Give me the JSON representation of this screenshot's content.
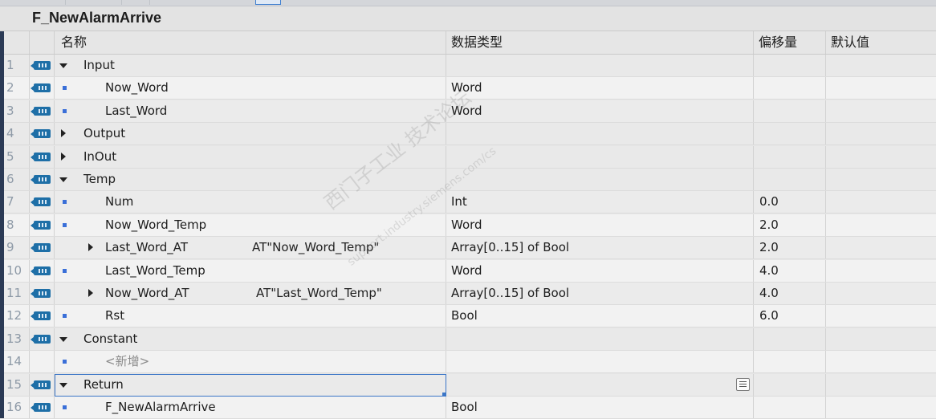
{
  "block_title": "F_NewAlarmArrive",
  "columns": {
    "name": "名称",
    "datatype": "数据类型",
    "offset": "偏移量",
    "default": "默认值"
  },
  "watermark": {
    "main": "西门子工业 技术论坛",
    "url": "support.industry.siemens.com/cs"
  },
  "rows": [
    {
      "num": "1",
      "icon": true,
      "expander": "down",
      "bullet": false,
      "name": "Input",
      "at": "",
      "type": "",
      "offset": ""
    },
    {
      "num": "2",
      "icon": true,
      "expander": "",
      "bullet": true,
      "name": "Now_Word",
      "at": "",
      "type": "Word",
      "offset": ""
    },
    {
      "num": "3",
      "icon": true,
      "expander": "",
      "bullet": true,
      "name": "Last_Word",
      "at": "",
      "type": "Word",
      "offset": ""
    },
    {
      "num": "4",
      "icon": true,
      "expander": "right",
      "bullet": false,
      "name": "Output",
      "at": "",
      "type": "",
      "offset": ""
    },
    {
      "num": "5",
      "icon": true,
      "expander": "right",
      "bullet": false,
      "name": "InOut",
      "at": "",
      "type": "",
      "offset": ""
    },
    {
      "num": "6",
      "icon": true,
      "expander": "down",
      "bullet": false,
      "name": "Temp",
      "at": "",
      "type": "",
      "offset": ""
    },
    {
      "num": "7",
      "icon": true,
      "expander": "",
      "bullet": true,
      "name": "Num",
      "at": "",
      "type": "Int",
      "offset": "0.0"
    },
    {
      "num": "8",
      "icon": true,
      "expander": "",
      "bullet": true,
      "name": "Now_Word_Temp",
      "at": "",
      "type": "Word",
      "offset": "2.0"
    },
    {
      "num": "9",
      "icon": true,
      "expander": "right-child",
      "bullet": false,
      "name": "Last_Word_AT",
      "at": "AT\"Now_Word_Temp\"",
      "type": "Array[0..15] of Bool",
      "offset": "2.0"
    },
    {
      "num": "10",
      "icon": true,
      "expander": "",
      "bullet": true,
      "name": "Last_Word_Temp",
      "at": "",
      "type": "Word",
      "offset": "4.0"
    },
    {
      "num": "11",
      "icon": true,
      "expander": "right-child",
      "bullet": false,
      "name": "Now_Word_AT",
      "at": "AT\"Last_Word_Temp\"",
      "type": "Array[0..15] of Bool",
      "offset": "4.0"
    },
    {
      "num": "12",
      "icon": true,
      "expander": "",
      "bullet": true,
      "name": "Rst",
      "at": "",
      "type": "Bool",
      "offset": "6.0"
    },
    {
      "num": "13",
      "icon": true,
      "expander": "down",
      "bullet": false,
      "name": "Constant",
      "at": "",
      "type": "",
      "offset": ""
    },
    {
      "num": "14",
      "icon": false,
      "expander": "",
      "bullet": true,
      "name": "<新增>",
      "at": "",
      "type": "",
      "offset": ""
    },
    {
      "num": "15",
      "icon": true,
      "expander": "down",
      "bullet": false,
      "name": "Return",
      "at": "",
      "type": "",
      "offset": ""
    },
    {
      "num": "16",
      "icon": true,
      "expander": "",
      "bullet": true,
      "name": "F_NewAlarmArrive",
      "at": "",
      "type": "Bool",
      "offset": ""
    }
  ]
}
